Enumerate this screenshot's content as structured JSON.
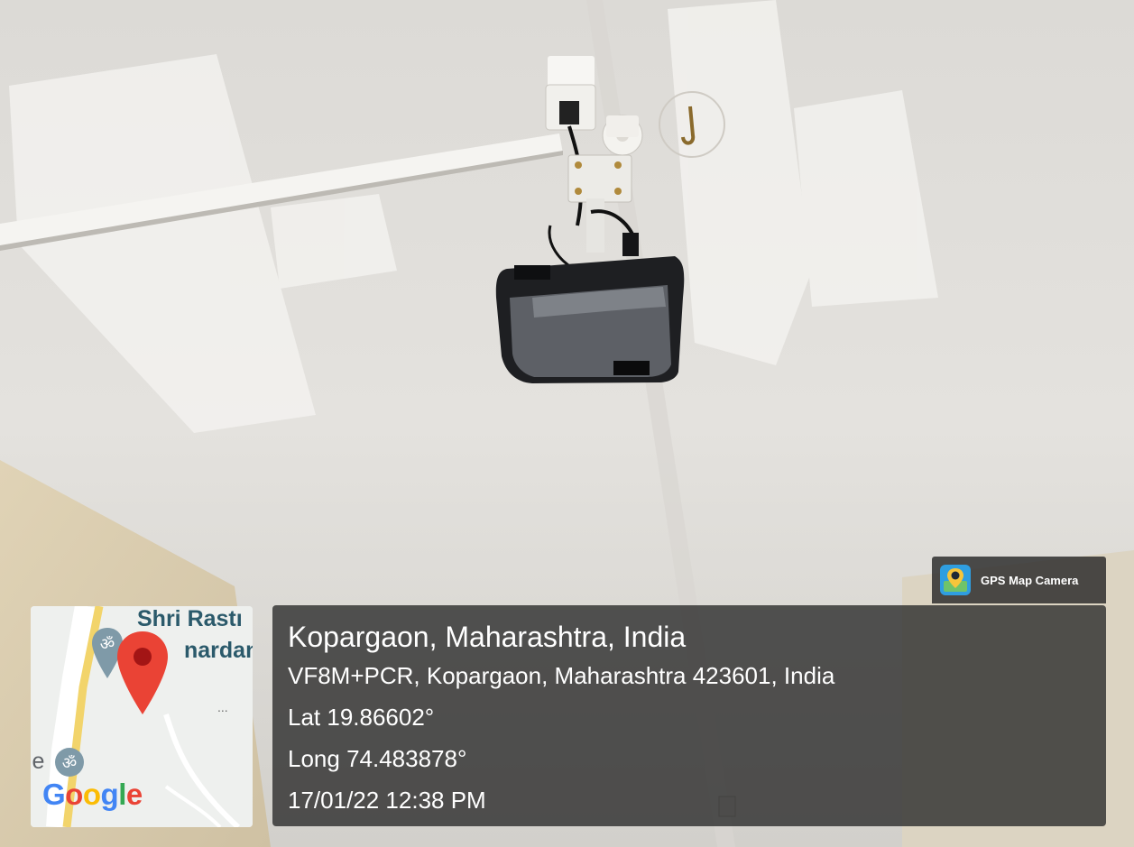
{
  "badge": {
    "app_name": "GPS Map Camera",
    "icon": "gps-map-camera-app-icon"
  },
  "location": {
    "title": "Kopargaon, Maharashtra, India",
    "address": "VF8M+PCR, Kopargaon, Maharashtra 423601, India",
    "latitude": "Lat 19.86602°",
    "longitude": "Long 74.483878°",
    "timestamp": "17/01/22 12:38 PM"
  },
  "map": {
    "label_top": "Shri Rastı",
    "label_second": "nardan",
    "label_left": "le",
    "ellipsis": "...",
    "logo_text": "Google",
    "pin_color": "#ea4335"
  },
  "colors": {
    "panel": "#282828",
    "text": "#ffffff"
  }
}
